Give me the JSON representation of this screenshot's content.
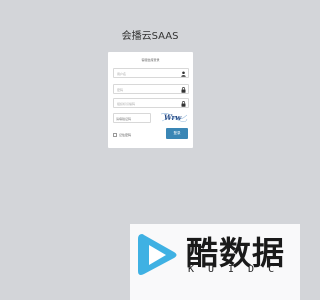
{
  "app": {
    "title": "会播云SAAS"
  },
  "login": {
    "heading": "客服坐席登录",
    "username_placeholder": "用户名",
    "password_placeholder": "密码",
    "org_placeholder": "组织标识编码",
    "captcha_placeholder": "请填验证码",
    "remember_label": "记住密码",
    "login_label": "登录"
  },
  "captcha": {
    "text": "Wrw"
  },
  "watermark": {
    "brand": "酷数据",
    "sub": "KUIDC"
  },
  "colors": {
    "background": "#d3d5d9",
    "button": "#3a86b5",
    "logo": "#3fb1e3"
  },
  "icons": {
    "username": "user-icon",
    "password": "lock-icon",
    "org": "lock-icon"
  }
}
